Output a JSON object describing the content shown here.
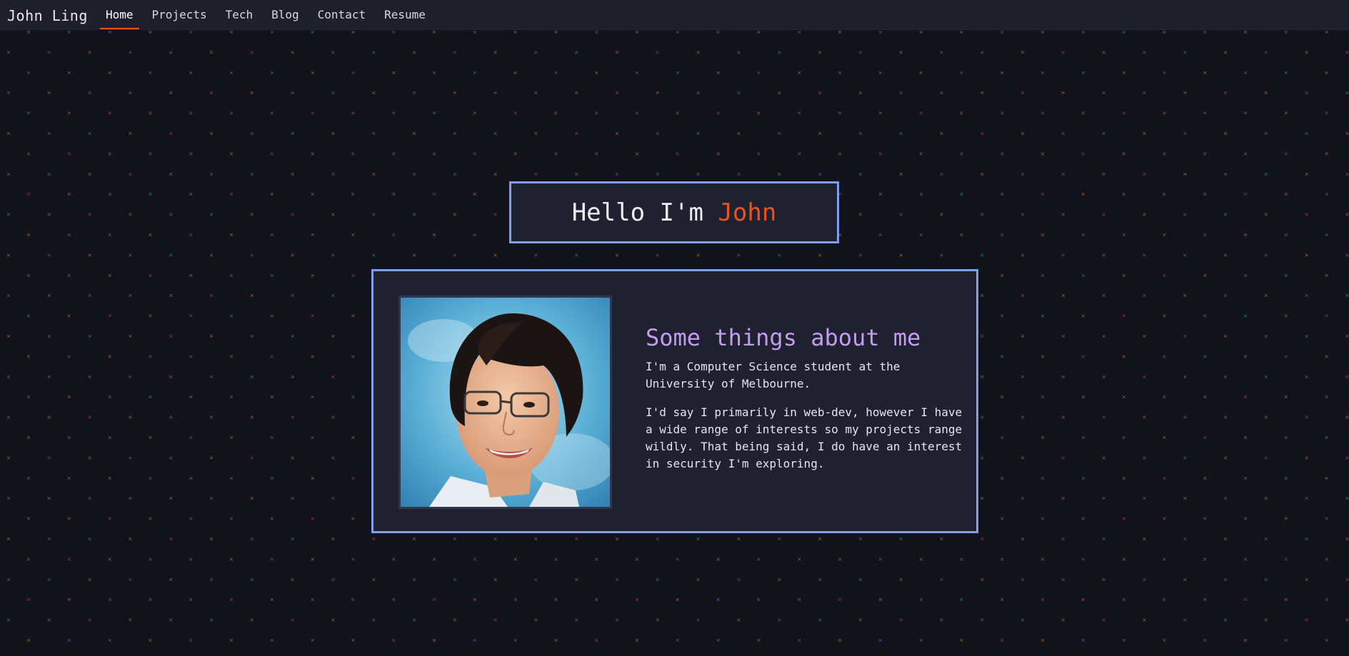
{
  "nav": {
    "brand": "John Ling",
    "links": [
      {
        "label": "Home",
        "active": true
      },
      {
        "label": "Projects",
        "active": false
      },
      {
        "label": "Tech",
        "active": false
      },
      {
        "label": "Blog",
        "active": false
      },
      {
        "label": "Contact",
        "active": false
      },
      {
        "label": "Resume",
        "active": false
      }
    ]
  },
  "hero": {
    "greeting": "Hello I'm ",
    "name": "John"
  },
  "about": {
    "heading": "Some things about me",
    "paragraphs": [
      "I'm a Computer Science student at the University of Melbourne.",
      "I'd say I primarily in web-dev, however I have a wide range of interests so my projects range wildly. That being said, I do have an interest in security I'm exploring."
    ],
    "photo_alt": "portrait-photo"
  },
  "colors": {
    "background": "#11121a",
    "navbar": "#1e1f2b",
    "card": "#1f2130",
    "border": "#7f9ef0",
    "accent": "#e8541b",
    "heading": "#c39bef",
    "pattern": [
      "#b06a3a",
      "#6d5fb3",
      "#2e8a8a",
      "#8a7a3a",
      "#9c4a4a"
    ]
  }
}
